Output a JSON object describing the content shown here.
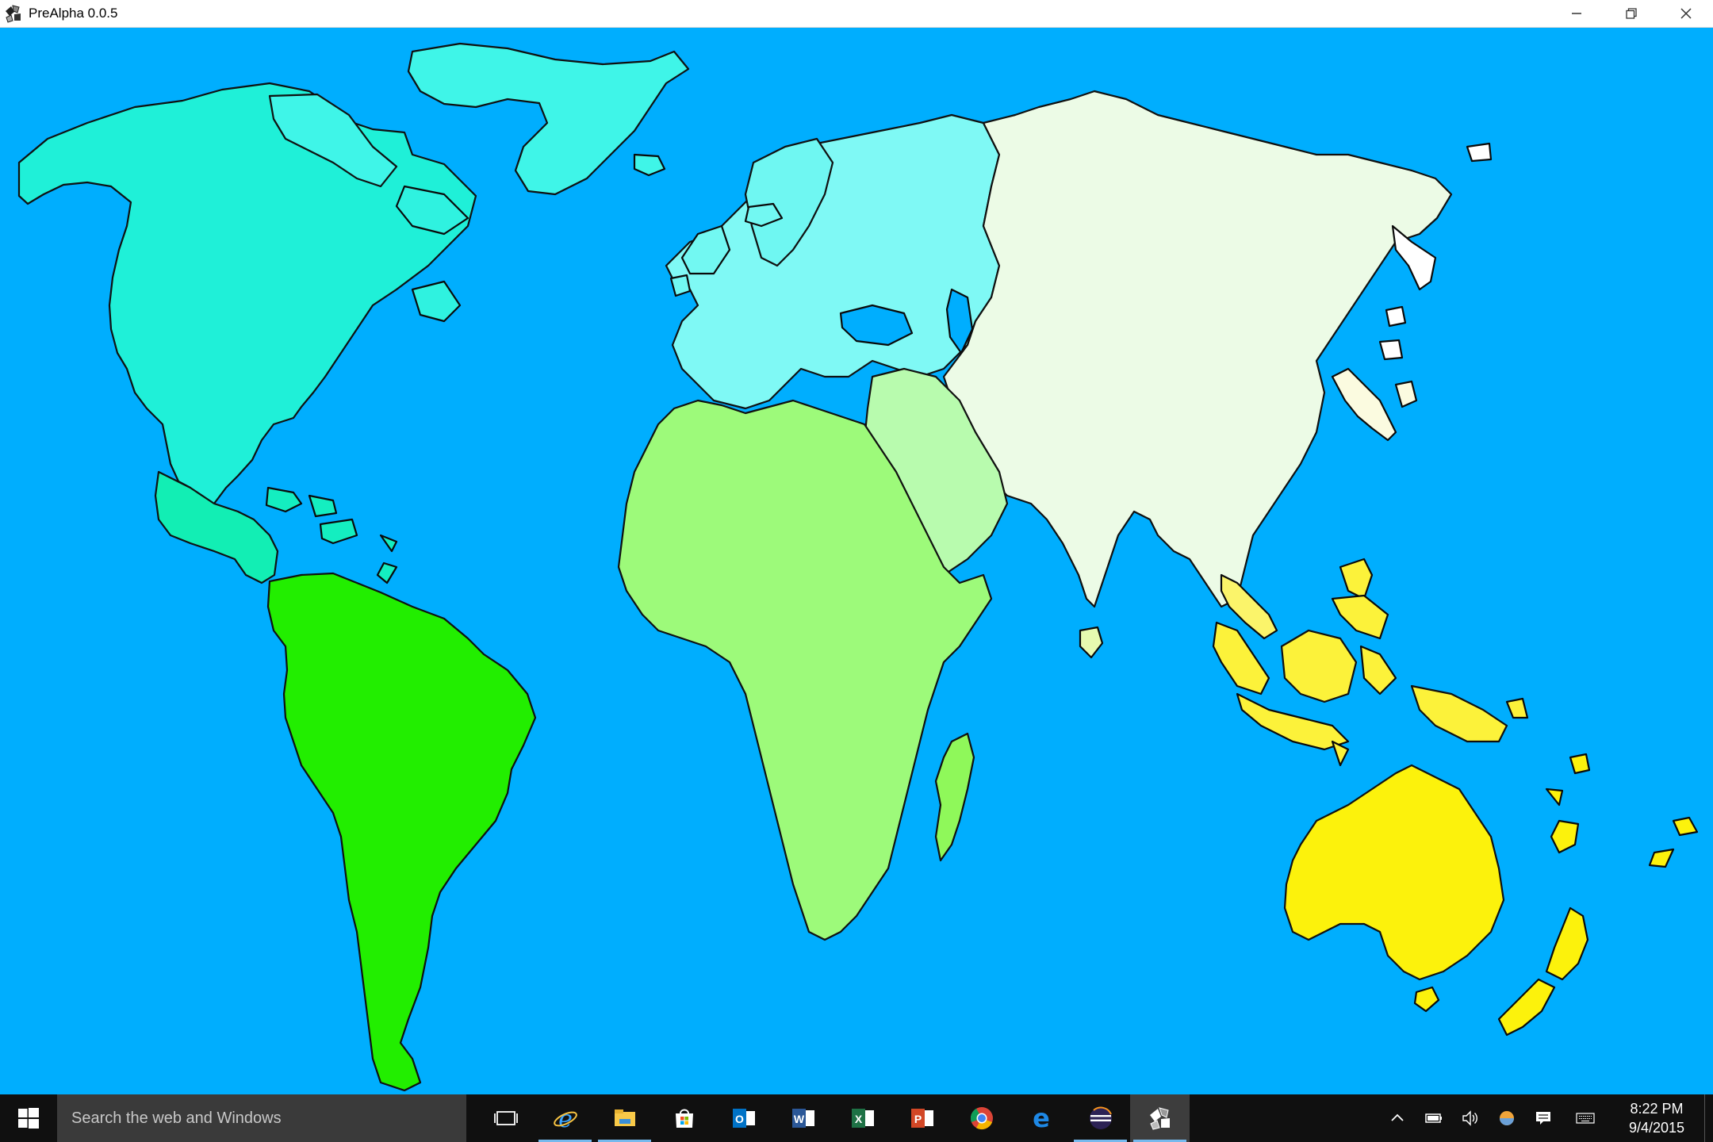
{
  "window": {
    "title": "PreAlpha 0.0.5",
    "icon": "app-icon",
    "controls": [
      "minimize-icon",
      "restore-icon",
      "close-icon"
    ]
  },
  "map": {
    "ocean_color": "#00aefe",
    "border_color": "#000000",
    "continent_colors": {
      "north_america": "#1ff0d8",
      "south_america": "#22ee00",
      "europe": "#7ff9f5",
      "asia": "#f2fbdc",
      "africa": "#9dfa7a",
      "australia": "#fcf20c"
    }
  },
  "taskbar": {
    "search_placeholder": "Search the web and Windows",
    "apps": [
      {
        "name": "task-view",
        "icon": "task-view-icon"
      },
      {
        "name": "internet-explorer",
        "icon": "internet-explorer-icon"
      },
      {
        "name": "file-explorer",
        "icon": "file-explorer-icon"
      },
      {
        "name": "store",
        "icon": "store-icon"
      },
      {
        "name": "outlook",
        "icon": "outlook-icon"
      },
      {
        "name": "word",
        "icon": "word-icon"
      },
      {
        "name": "excel",
        "icon": "excel-icon"
      },
      {
        "name": "powerpoint",
        "icon": "powerpoint-icon"
      },
      {
        "name": "chrome",
        "icon": "chrome-icon"
      },
      {
        "name": "edge",
        "icon": "edge-icon"
      },
      {
        "name": "eclipse",
        "icon": "eclipse-icon"
      },
      {
        "name": "prealpha",
        "icon": "prealpha-icon"
      }
    ],
    "tray": [
      "chevron-up-icon",
      "battery-icon",
      "volume-icon",
      "network-icon",
      "action-center-icon",
      "keyboard-icon"
    ],
    "clock": {
      "time": "8:22 PM",
      "date": "9/4/2015"
    }
  }
}
